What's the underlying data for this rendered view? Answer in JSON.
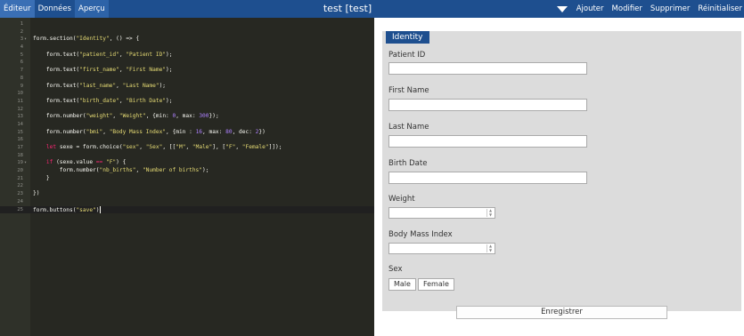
{
  "topbar": {
    "tabs": [
      {
        "label": "Éditeur"
      },
      {
        "label": "Données"
      },
      {
        "label": "Aperçu"
      }
    ],
    "title": "test [test]",
    "actions": [
      "Ajouter",
      "Modifier",
      "Supprimer",
      "Réinitialiser"
    ]
  },
  "editor": {
    "lines": [
      {
        "n": "1",
        "fold": "",
        "html": ""
      },
      {
        "n": "2",
        "fold": "",
        "html": ""
      },
      {
        "n": "3",
        "fold": "▾",
        "html": "form.section(<span class=\"str\">\"Identity\"</span>, () =&gt; {"
      },
      {
        "n": "4",
        "fold": "",
        "html": ""
      },
      {
        "n": "5",
        "fold": "",
        "html": "    form.text(<span class=\"str\">\"patient_id\"</span>, <span class=\"str\">\"Patient ID\"</span>);"
      },
      {
        "n": "6",
        "fold": "",
        "html": ""
      },
      {
        "n": "7",
        "fold": "",
        "html": "    form.text(<span class=\"str\">\"first_name\"</span>, <span class=\"str\">\"First Name\"</span>);"
      },
      {
        "n": "8",
        "fold": "",
        "html": ""
      },
      {
        "n": "9",
        "fold": "",
        "html": "    form.text(<span class=\"str\">\"last_name\"</span>, <span class=\"str\">\"Last Name\"</span>);"
      },
      {
        "n": "10",
        "fold": "",
        "html": ""
      },
      {
        "n": "11",
        "fold": "",
        "html": "    form.text(<span class=\"str\">\"birth_date\"</span>, <span class=\"str\">\"Birth Date\"</span>);"
      },
      {
        "n": "12",
        "fold": "",
        "html": ""
      },
      {
        "n": "13",
        "fold": "",
        "html": "    form.number(<span class=\"str\">\"weight\"</span>, <span class=\"str\">\"Weight\"</span>, {min: <span class=\"num\">0</span>, max: <span class=\"num\">300</span>});"
      },
      {
        "n": "14",
        "fold": "",
        "html": ""
      },
      {
        "n": "15",
        "fold": "",
        "html": "    form.number(<span class=\"str\">\"bmi\"</span>, <span class=\"str\">\"Body Mass Index\"</span>, {min : <span class=\"num\">16</span>, max: <span class=\"num\">80</span>, dec: <span class=\"num\">2</span>})"
      },
      {
        "n": "16",
        "fold": "",
        "html": ""
      },
      {
        "n": "17",
        "fold": "",
        "html": "    <span class=\"kw\">let</span> sexe = form.choice(<span class=\"str\">\"sex\"</span>, <span class=\"str\">\"Sex\"</span>, [[<span class=\"str\">\"M\"</span>, <span class=\"str\">\"Male\"</span>], [<span class=\"str\">\"F\"</span>, <span class=\"str\">\"Female\"</span>]]);"
      },
      {
        "n": "18",
        "fold": "",
        "html": ""
      },
      {
        "n": "19",
        "fold": "▾",
        "html": "    <span class=\"kw\">if</span> (sexe.value <span class=\"kw\">==</span> <span class=\"str\">\"F\"</span>) {"
      },
      {
        "n": "20",
        "fold": "",
        "html": "        form.number(<span class=\"str\">\"nb_births\"</span>, <span class=\"str\">\"Number of births\"</span>);"
      },
      {
        "n": "21",
        "fold": "",
        "html": "    }"
      },
      {
        "n": "22",
        "fold": "",
        "html": ""
      },
      {
        "n": "23",
        "fold": "",
        "html": "})"
      },
      {
        "n": "24",
        "fold": "",
        "html": ""
      },
      {
        "n": "25",
        "fold": "",
        "html": "form.buttons(<span class=\"str\">\"save\"</span>)<span class=\"cursor\"></span>",
        "active": true
      }
    ]
  },
  "form": {
    "section_title": "Identity",
    "fields": {
      "patient_id": {
        "label": "Patient ID",
        "value": ""
      },
      "first_name": {
        "label": "First Name",
        "value": ""
      },
      "last_name": {
        "label": "Last Name",
        "value": ""
      },
      "birth_date": {
        "label": "Birth Date",
        "value": ""
      },
      "weight": {
        "label": "Weight",
        "value": ""
      },
      "bmi": {
        "label": "Body Mass Index",
        "value": ""
      },
      "sex": {
        "label": "Sex",
        "options": [
          "Male",
          "Female"
        ]
      }
    },
    "save_label": "Enregistrer"
  },
  "colors": {
    "topbar": "#1e4f8f",
    "editor_bg": "#272822",
    "section_bg": "#dcdcdc"
  }
}
